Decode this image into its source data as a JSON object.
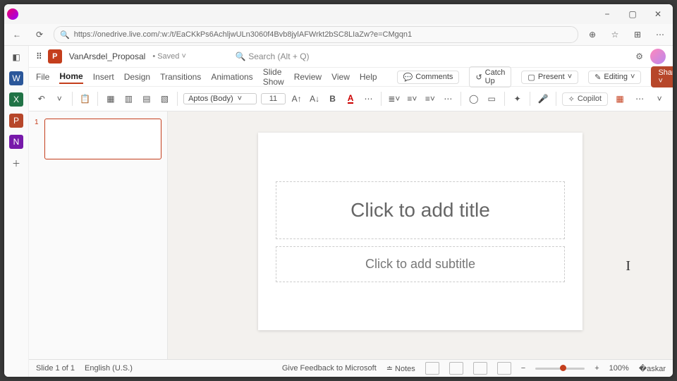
{
  "browser": {
    "url": "https://onedrive.live.com/:w:/t/EaCKkPs6AchljwULn3060f4Bvb8jylAFWrkt2bSC8LIaZw?e=CMgqn1"
  },
  "header": {
    "waffle": "⋮⋮⋮",
    "docname": "VanArsdel_Proposal",
    "savestate": "• Saved ˅",
    "search_placeholder": "Search (Alt + Q)"
  },
  "tabs": {
    "file": "File",
    "home": "Home",
    "insert": "Insert",
    "design": "Design",
    "transitions": "Transitions",
    "animations": "Animations",
    "slideshow": "Slide Show",
    "review": "Review",
    "view": "View",
    "help": "Help"
  },
  "chips": {
    "comments": "Comments",
    "catchup": "Catch Up",
    "present": "Present",
    "editing": "Editing",
    "share": "Share"
  },
  "ribbon": {
    "font": "Aptos (Body)",
    "size": "11",
    "copilot": "Copilot"
  },
  "slide": {
    "title_ph": "Click to add title",
    "subtitle_ph": "Click to add subtitle",
    "thumb_num": "1"
  },
  "status": {
    "slide": "Slide 1 of 1",
    "lang": "English (U.S.)",
    "feedback": "Give Feedback to Microsoft",
    "notes": "Notes",
    "zoom": "100%"
  }
}
